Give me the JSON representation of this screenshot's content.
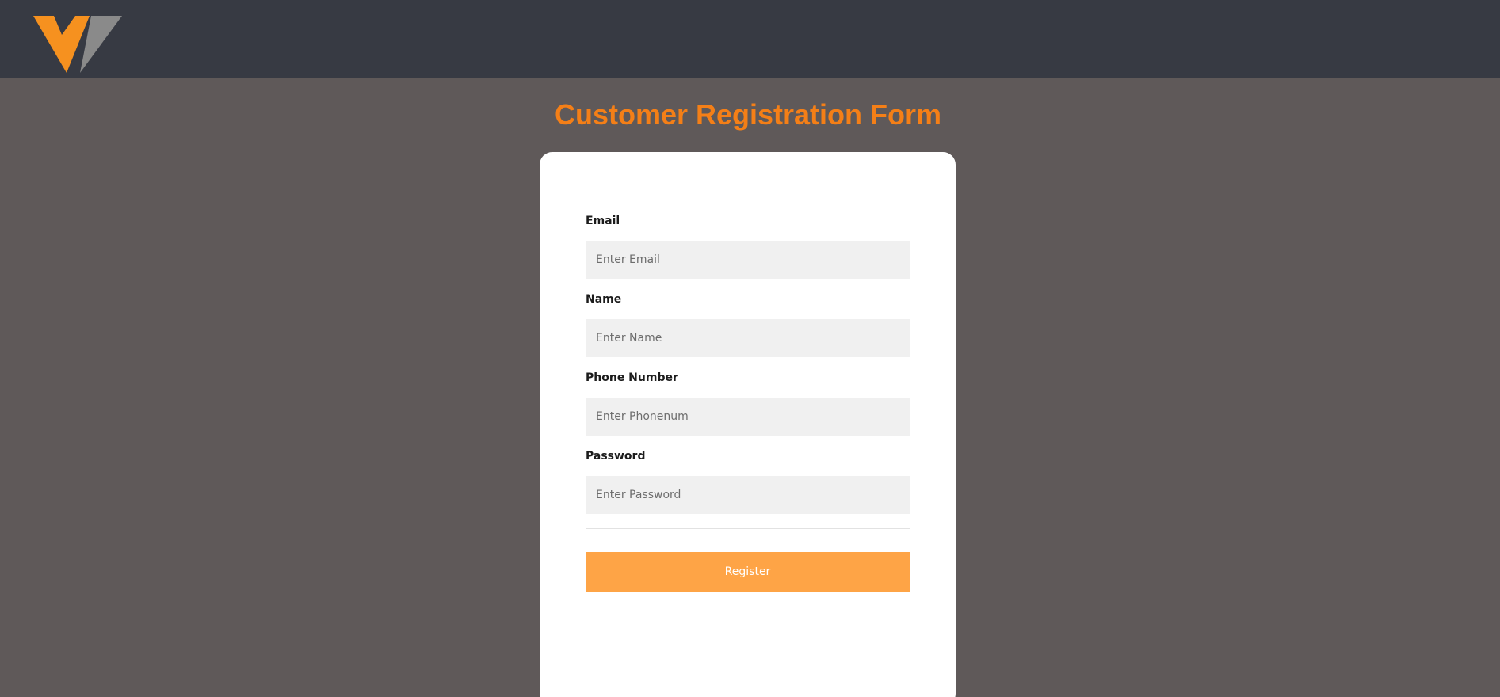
{
  "header": {
    "logo_icon": "brand-logo-v-icon",
    "colors": {
      "bar": "#373a43",
      "logo_primary": "#f6911f",
      "logo_secondary": "#8a8a8a"
    }
  },
  "page": {
    "title": "Customer Registration Form",
    "colors": {
      "background": "#5f5959",
      "title": "#f47f17"
    }
  },
  "form": {
    "fields": [
      {
        "label": "Email",
        "placeholder": "Enter Email",
        "value": ""
      },
      {
        "label": "Name",
        "placeholder": "Enter Name",
        "value": ""
      },
      {
        "label": "Phone Number",
        "placeholder": "Enter Phonenum",
        "value": ""
      },
      {
        "label": "Password",
        "placeholder": "Enter Password",
        "value": ""
      }
    ],
    "submit_label": "Register",
    "colors": {
      "card": "#ffffff",
      "input_bg": "#f0f0f0",
      "button": "#fea446"
    }
  }
}
